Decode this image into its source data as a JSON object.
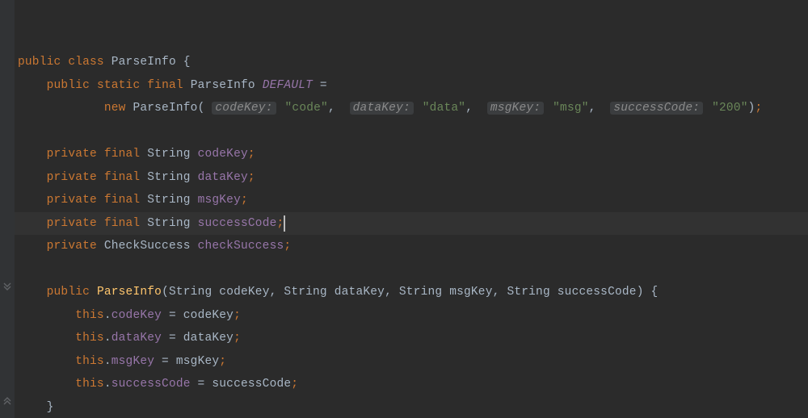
{
  "code": {
    "line1": {
      "public": "public",
      "class": "class",
      "name": "ParseInfo",
      "brace": " {"
    },
    "line2": {
      "public": "public",
      "static": "static",
      "final": "final",
      "type": "ParseInfo",
      "name": "DEFAULT",
      "eq": " ="
    },
    "line3": {
      "new": "new",
      "ctor": "ParseInfo",
      "lp": "(",
      "hint1": "codeKey:",
      "str1": "\"code\"",
      "c1": ", ",
      "hint2": "dataKey:",
      "str2": "\"data\"",
      "c2": ", ",
      "hint3": "msgKey:",
      "str3": "\"msg\"",
      "c3": ", ",
      "hint4": "successCode:",
      "str4": "\"200\"",
      "rp": ")",
      "semi": ";"
    },
    "f1": {
      "priv": "private",
      "final": "final",
      "type": "String",
      "name": "codeKey",
      "semi": ";"
    },
    "f2": {
      "priv": "private",
      "final": "final",
      "type": "String",
      "name": "dataKey",
      "semi": ";"
    },
    "f3": {
      "priv": "private",
      "final": "final",
      "type": "String",
      "name": "msgKey",
      "semi": ";"
    },
    "f4": {
      "priv": "private",
      "final": "final",
      "type": "String",
      "name": "successCode",
      "semi": ";"
    },
    "f5": {
      "priv": "private",
      "type": "CheckSuccess",
      "name": "checkSuccess",
      "semi": ";"
    },
    "ctor": {
      "public": "public",
      "name": "ParseInfo",
      "lp": "(",
      "p1t": "String",
      "p1n": "codeKey",
      "c1": ", ",
      "p2t": "String",
      "p2n": "dataKey",
      "c2": ", ",
      "p3t": "String",
      "p3n": "msgKey",
      "c3": ", ",
      "p4t": "String",
      "p4n": "successCode",
      "rp": ")",
      "brace": " {"
    },
    "a1": {
      "this": "this",
      "dot": ".",
      "field": "codeKey",
      "eq": " = ",
      "val": "codeKey",
      "semi": ";"
    },
    "a2": {
      "this": "this",
      "dot": ".",
      "field": "dataKey",
      "eq": " = ",
      "val": "dataKey",
      "semi": ";"
    },
    "a3": {
      "this": "this",
      "dot": ".",
      "field": "msgKey",
      "eq": " = ",
      "val": "msgKey",
      "semi": ";"
    },
    "a4": {
      "this": "this",
      "dot": ".",
      "field": "successCode",
      "eq": " = ",
      "val": "successCode",
      "semi": ";"
    },
    "end": {
      "brace": "}"
    }
  }
}
